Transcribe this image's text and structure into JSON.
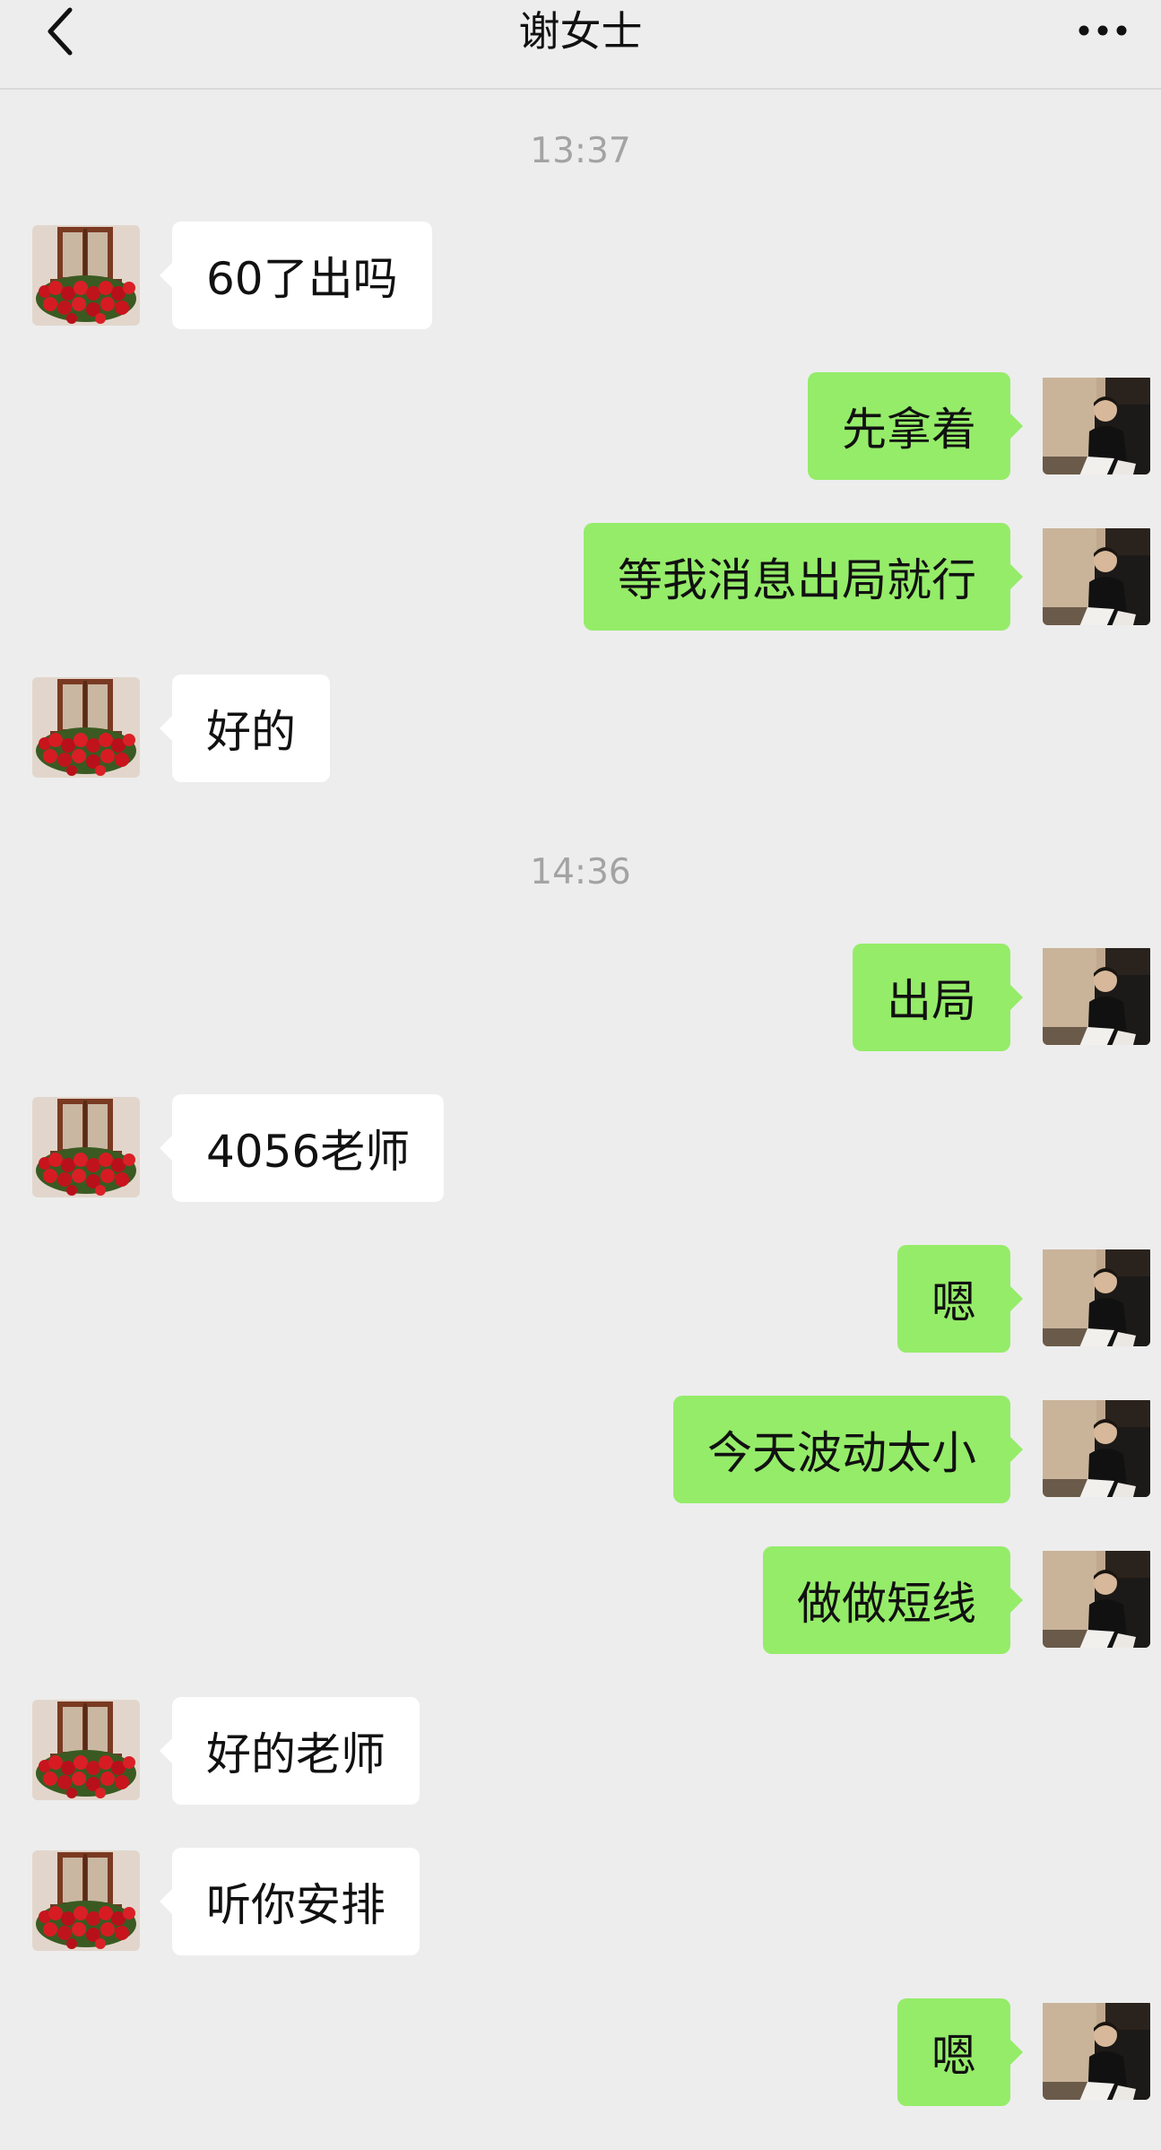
{
  "header": {
    "title": "谢女士",
    "back_icon": "chevron-left-icon",
    "more_icon": "more-dots-icon"
  },
  "colors": {
    "background": "#ededed",
    "sent_bubble": "#95ec69",
    "received_bubble": "#ffffff",
    "timestamp": "#a3a3a3"
  },
  "timestamps": [
    "13:37",
    "14:36"
  ],
  "messages": [
    {
      "from": "contact",
      "text": "60了出吗"
    },
    {
      "from": "me",
      "text": "先拿着"
    },
    {
      "from": "me",
      "text": "等我消息出局就行"
    },
    {
      "from": "contact",
      "text": "好的"
    },
    {
      "from": "me",
      "text": "出局"
    },
    {
      "from": "contact",
      "text": "4056老师"
    },
    {
      "from": "me",
      "text": "嗯"
    },
    {
      "from": "me",
      "text": "今天波动太小"
    },
    {
      "from": "me",
      "text": "做做短线"
    },
    {
      "from": "contact",
      "text": "好的老师"
    },
    {
      "from": "contact",
      "text": "听你安排"
    },
    {
      "from": "me",
      "text": "嗯"
    }
  ]
}
